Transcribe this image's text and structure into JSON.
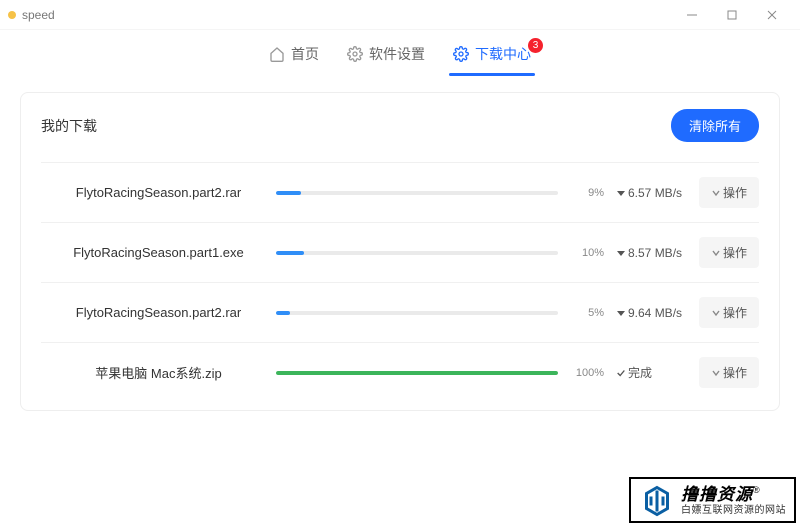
{
  "window": {
    "title": "speed"
  },
  "tabs": {
    "home": "首页",
    "settings": "软件设置",
    "downloads": "下载中心",
    "badge": "3"
  },
  "card": {
    "title": "我的下载",
    "clear_label": "清除所有"
  },
  "action_label": "操作",
  "downloads": [
    {
      "name": "FlytoRacingSeason.part2.rar",
      "percent": 9,
      "percent_label": "9%",
      "status_type": "speed",
      "status": "6.57 MB/s"
    },
    {
      "name": "FlytoRacingSeason.part1.exe",
      "percent": 10,
      "percent_label": "10%",
      "status_type": "speed",
      "status": "8.57 MB/s"
    },
    {
      "name": "FlytoRacingSeason.part2.rar",
      "percent": 5,
      "percent_label": "5%",
      "status_type": "speed",
      "status": "9.64 MB/s"
    },
    {
      "name": "苹果电脑 Mac系统.zip",
      "percent": 100,
      "percent_label": "100%",
      "status_type": "done",
      "status": "完成"
    }
  ],
  "watermark": {
    "main": "撸撸资源",
    "r": "®",
    "sub": "白嫖互联网资源的网站"
  }
}
